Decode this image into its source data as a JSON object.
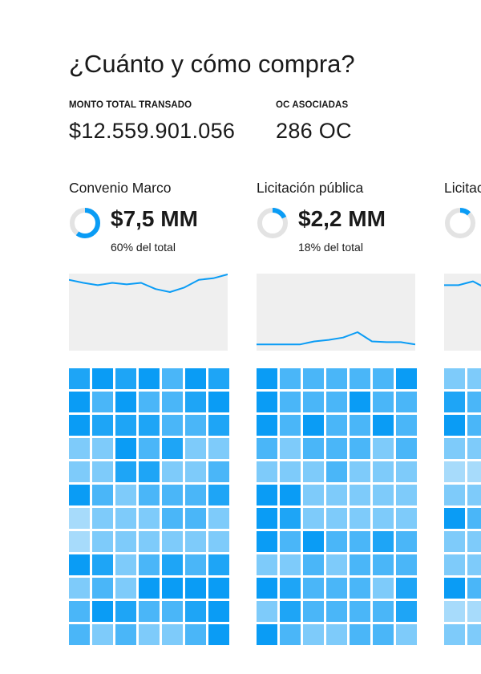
{
  "title": "¿Cuánto y cómo compra?",
  "stats": {
    "monto_label": "MONTO TOTAL TRANSADO",
    "monto_value": "$12.559.901.056",
    "oc_label": "OC ASOCIADAS",
    "oc_value": "286 OC"
  },
  "colors": {
    "accent": "#0a9cf5",
    "ring_track": "#e3e3e3",
    "spark_bg": "#efefef",
    "shades": [
      "#cfeafc",
      "#a7dbfb",
      "#7ecbfa",
      "#4ab6f8",
      "#1ea5f6",
      "#0a9cf5"
    ]
  },
  "cards": [
    {
      "name": "Convenio Marco",
      "amount": "$7,5 MM",
      "share_label": "60% del total",
      "share_fraction": 0.6,
      "trend": [
        8,
        12,
        15,
        12,
        14,
        12,
        20,
        24,
        18,
        8,
        6,
        1
      ],
      "trend_max": 100,
      "cells": [
        4,
        5,
        4,
        5,
        3,
        5,
        4,
        5,
        3,
        5,
        3,
        3,
        4,
        5,
        5,
        4,
        4,
        4,
        3,
        3,
        4,
        2,
        2,
        5,
        3,
        4,
        2,
        2,
        2,
        2,
        4,
        4,
        2,
        2,
        3,
        5,
        3,
        2,
        3,
        3,
        3,
        4,
        1,
        2,
        2,
        2,
        3,
        3,
        2,
        1,
        2,
        2,
        2,
        2,
        2,
        2,
        5,
        4,
        2,
        3,
        4,
        3,
        4,
        2,
        3,
        2,
        5,
        5,
        5,
        5,
        3,
        5,
        4,
        3,
        3,
        4,
        5,
        3,
        2,
        3,
        2,
        2,
        3,
        5
      ]
    },
    {
      "name": "Licitación pública",
      "amount": "$2,2 MM",
      "share_label": "18% del total",
      "share_fraction": 0.18,
      "trend": [
        92,
        92,
        92,
        92,
        88,
        86,
        83,
        76,
        88,
        89,
        89,
        92
      ],
      "trend_max": 100,
      "cells": [
        5,
        3,
        3,
        3,
        3,
        3,
        5,
        5,
        3,
        3,
        3,
        5,
        3,
        3,
        5,
        3,
        5,
        3,
        3,
        5,
        3,
        3,
        2,
        3,
        3,
        3,
        2,
        3,
        2,
        2,
        2,
        3,
        2,
        2,
        2,
        5,
        5,
        2,
        2,
        2,
        2,
        2,
        5,
        4,
        2,
        2,
        2,
        2,
        2,
        5,
        3,
        5,
        3,
        3,
        4,
        3,
        2,
        2,
        3,
        2,
        3,
        3,
        3,
        5,
        4,
        3,
        3,
        3,
        2,
        4,
        2,
        4,
        3,
        3,
        3,
        3,
        4,
        5,
        3,
        2,
        2,
        3,
        3,
        2
      ]
    },
    {
      "name": "Licitación privada",
      "amount": "",
      "share_label": "",
      "share_fraction": 0.12,
      "trend": [
        15,
        15,
        10,
        20,
        30,
        40,
        50,
        55,
        60,
        62,
        64,
        65
      ],
      "trend_max": 100,
      "cells": [
        2,
        2,
        2,
        2,
        2,
        2,
        2,
        4,
        3,
        3,
        3,
        3,
        3,
        3,
        5,
        3,
        3,
        3,
        3,
        3,
        3,
        2,
        2,
        2,
        2,
        2,
        2,
        2,
        1,
        1,
        1,
        1,
        1,
        1,
        1,
        2,
        2,
        2,
        2,
        2,
        2,
        2,
        5,
        3,
        3,
        3,
        3,
        3,
        3,
        2,
        2,
        2,
        2,
        2,
        2,
        2,
        2,
        2,
        2,
        2,
        2,
        2,
        2,
        5,
        3,
        3,
        3,
        3,
        3,
        3,
        1,
        1,
        1,
        1,
        1,
        1,
        1,
        2,
        2,
        2,
        2,
        2,
        2,
        2
      ]
    }
  ]
}
